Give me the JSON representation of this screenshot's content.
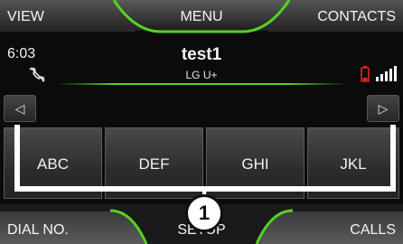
{
  "top_bar": {
    "left": "VIEW",
    "center": "MENU",
    "right": "CONTACTS"
  },
  "status": {
    "time": "6:03",
    "title": "test1",
    "operator": "LG U+"
  },
  "icons": {
    "no_signal": "phone-no-signal-icon",
    "battery": "battery-low-icon",
    "signal": "signal-strength-icon",
    "arrow_left": "◁",
    "arrow_right": "▷"
  },
  "keypad": [
    "ABC",
    "DEF",
    "GHI",
    "JKL"
  ],
  "bottom_bar": {
    "left": "DIAL NO.",
    "center": "SETUP",
    "right": "CALLS"
  },
  "callout": "1",
  "colors": {
    "accent_green": "#55d223",
    "battery_red": "#e1261c",
    "background": "#0b0b0b"
  }
}
